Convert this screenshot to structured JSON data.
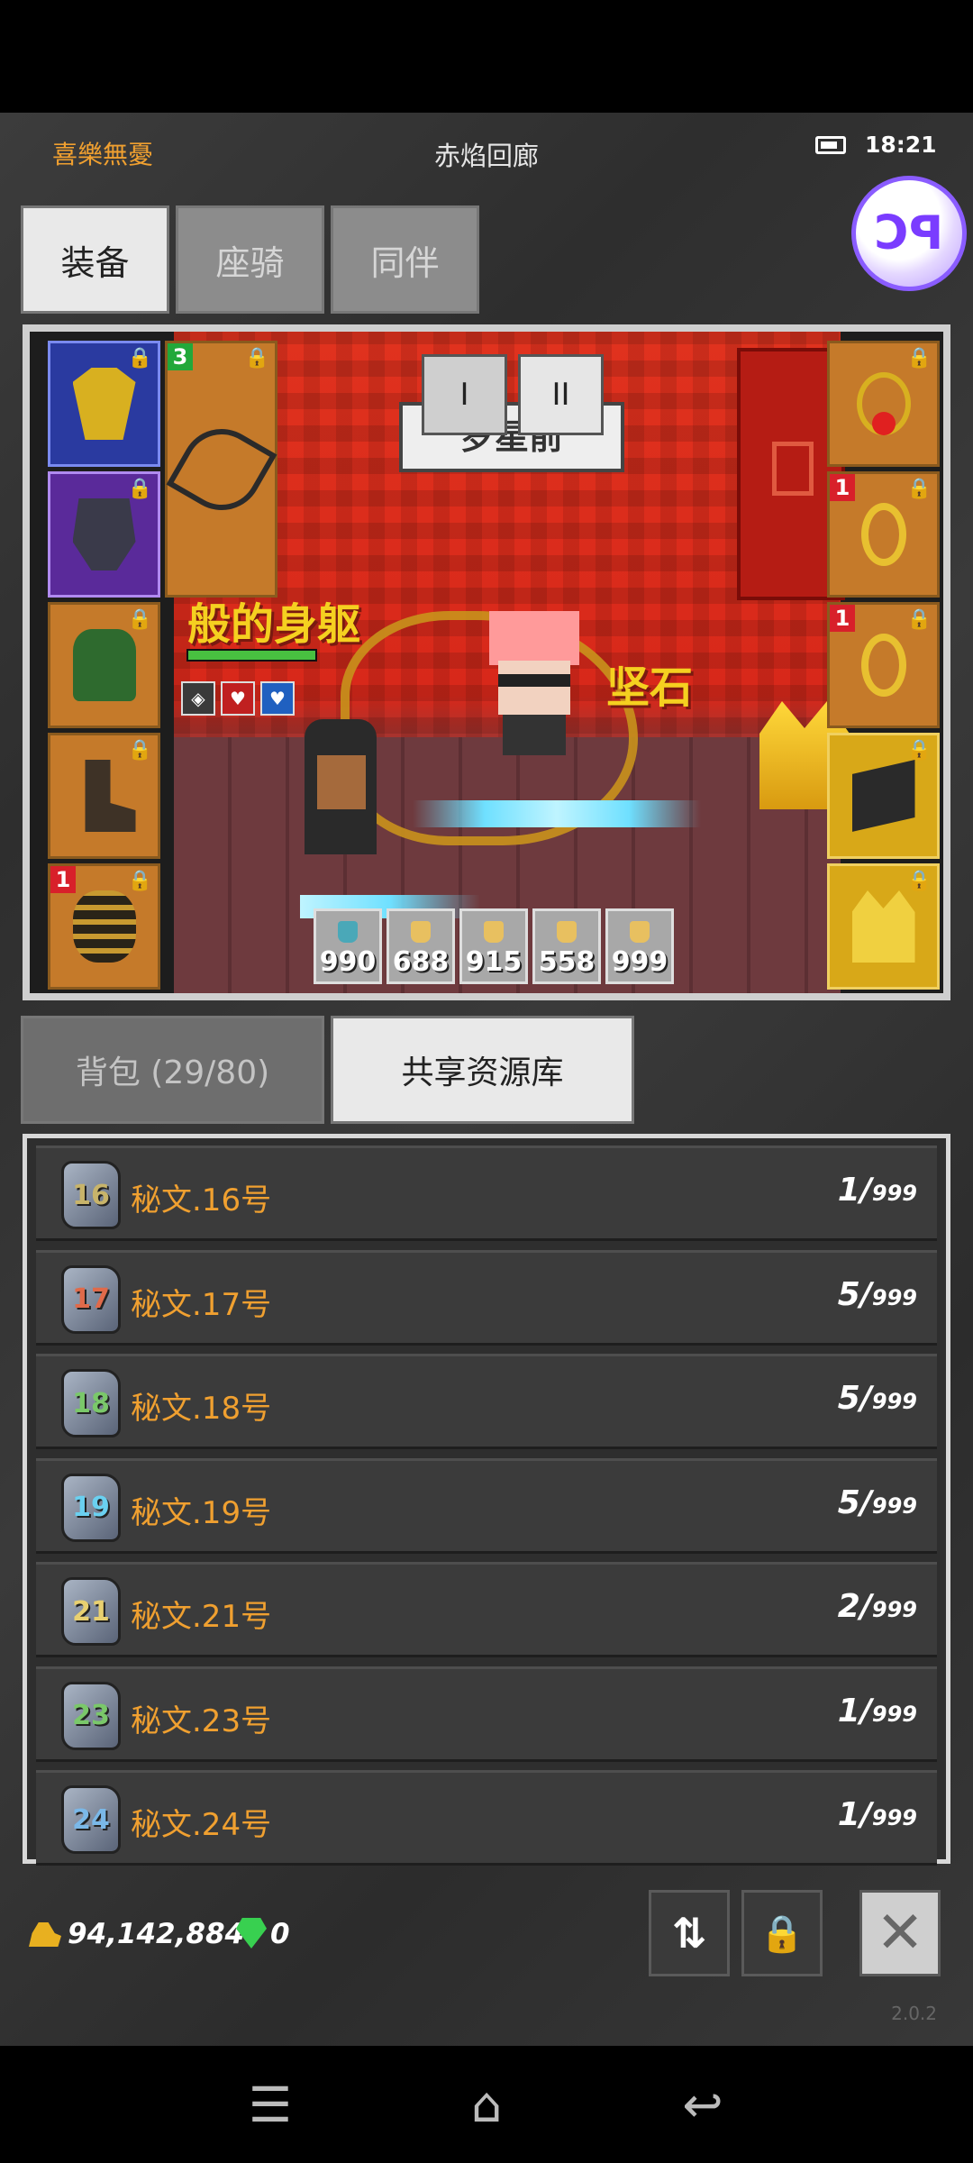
{
  "header": {
    "left_label": "喜樂無憂",
    "title": "赤焰回廊",
    "time": "18:21",
    "fab_icon": "ꓛꟼ"
  },
  "tabs": [
    {
      "label": "装备",
      "active": true
    },
    {
      "label": "座骑",
      "active": false
    },
    {
      "label": "同伴",
      "active": false
    }
  ],
  "game": {
    "pause_buttons": [
      "I",
      "II"
    ],
    "banner_text": "罗星前",
    "floating_text_left": "般的身躯",
    "floating_text_right": "坚石",
    "hp_fraction": 1.0,
    "potions": [
      "990",
      "688",
      "915",
      "558",
      "999"
    ],
    "left_slots": [
      {
        "badge": "",
        "color": "blue"
      },
      {
        "badge": "",
        "color": "purple"
      },
      {
        "badge": "",
        "color": "orange"
      },
      {
        "badge": "",
        "color": "orange"
      },
      {
        "badge": "1",
        "color": "orange"
      }
    ],
    "weapon_slot_badge": "3",
    "right_slots": [
      {
        "badge": "",
        "color": "orange"
      },
      {
        "badge": "1",
        "color": "orange"
      },
      {
        "badge": "1",
        "color": "orange"
      },
      {
        "badge": "",
        "color": "gold"
      },
      {
        "badge": "",
        "color": "gold"
      }
    ]
  },
  "resource_tabs": [
    {
      "label": "背包 (29/80)",
      "active": false
    },
    {
      "label": "共享资源库",
      "active": true
    }
  ],
  "items": [
    {
      "icon_num": "16",
      "name": "秘文.16号",
      "count": "1/",
      "max": "999",
      "color": "#c8b46a"
    },
    {
      "icon_num": "17",
      "name": "秘文.17号",
      "count": "5/",
      "max": "999",
      "color": "#e06a4a"
    },
    {
      "icon_num": "18",
      "name": "秘文.18号",
      "count": "5/",
      "max": "999",
      "color": "#7ac86a"
    },
    {
      "icon_num": "19",
      "name": "秘文.19号",
      "count": "5/",
      "max": "999",
      "color": "#6ad0f0"
    },
    {
      "icon_num": "21",
      "name": "秘文.21号",
      "count": "2/",
      "max": "999",
      "color": "#e8d070"
    },
    {
      "icon_num": "23",
      "name": "秘文.23号",
      "count": "1/",
      "max": "999",
      "color": "#7ac86a"
    },
    {
      "icon_num": "24",
      "name": "秘文.24号",
      "count": "1/",
      "max": "999",
      "color": "#7ab8e8"
    }
  ],
  "footer": {
    "gold": "94,142,884",
    "gems": "0",
    "sort_icon": "⇅",
    "lock_icon": "🔒",
    "close_icon": "✕",
    "version": "2.0.2"
  },
  "colors": {
    "accent_orange": "#f0a030",
    "tab_active_bg": "#e9e9e9",
    "tab_inactive_bg": "#8c8c8c"
  }
}
